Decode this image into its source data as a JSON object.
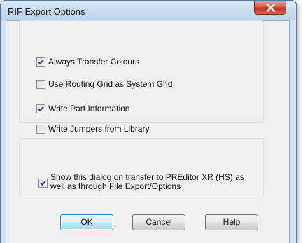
{
  "window": {
    "title": "RIF Export Options",
    "close_icon": "close-icon"
  },
  "options": [
    {
      "label": "Always Transfer Colours",
      "checked": true
    },
    {
      "label": "Use Routing Grid as System Grid",
      "checked": false
    },
    {
      "label": "Write Part Information",
      "checked": true
    },
    {
      "label": "Write Jumpers from Library",
      "checked": false
    }
  ],
  "show_dialog": {
    "label": "Show this dialog on transfer to PREditor XR (HS) as well as through File Export/Options",
    "checked": true
  },
  "buttons": {
    "ok": "OK",
    "cancel": "Cancel",
    "help": "Help"
  },
  "colors": {
    "titlebar": "#c9dcf1",
    "close_button": "#c0351c",
    "client_background": "#f0f0f0",
    "default_button_border": "#3c7fb1"
  }
}
